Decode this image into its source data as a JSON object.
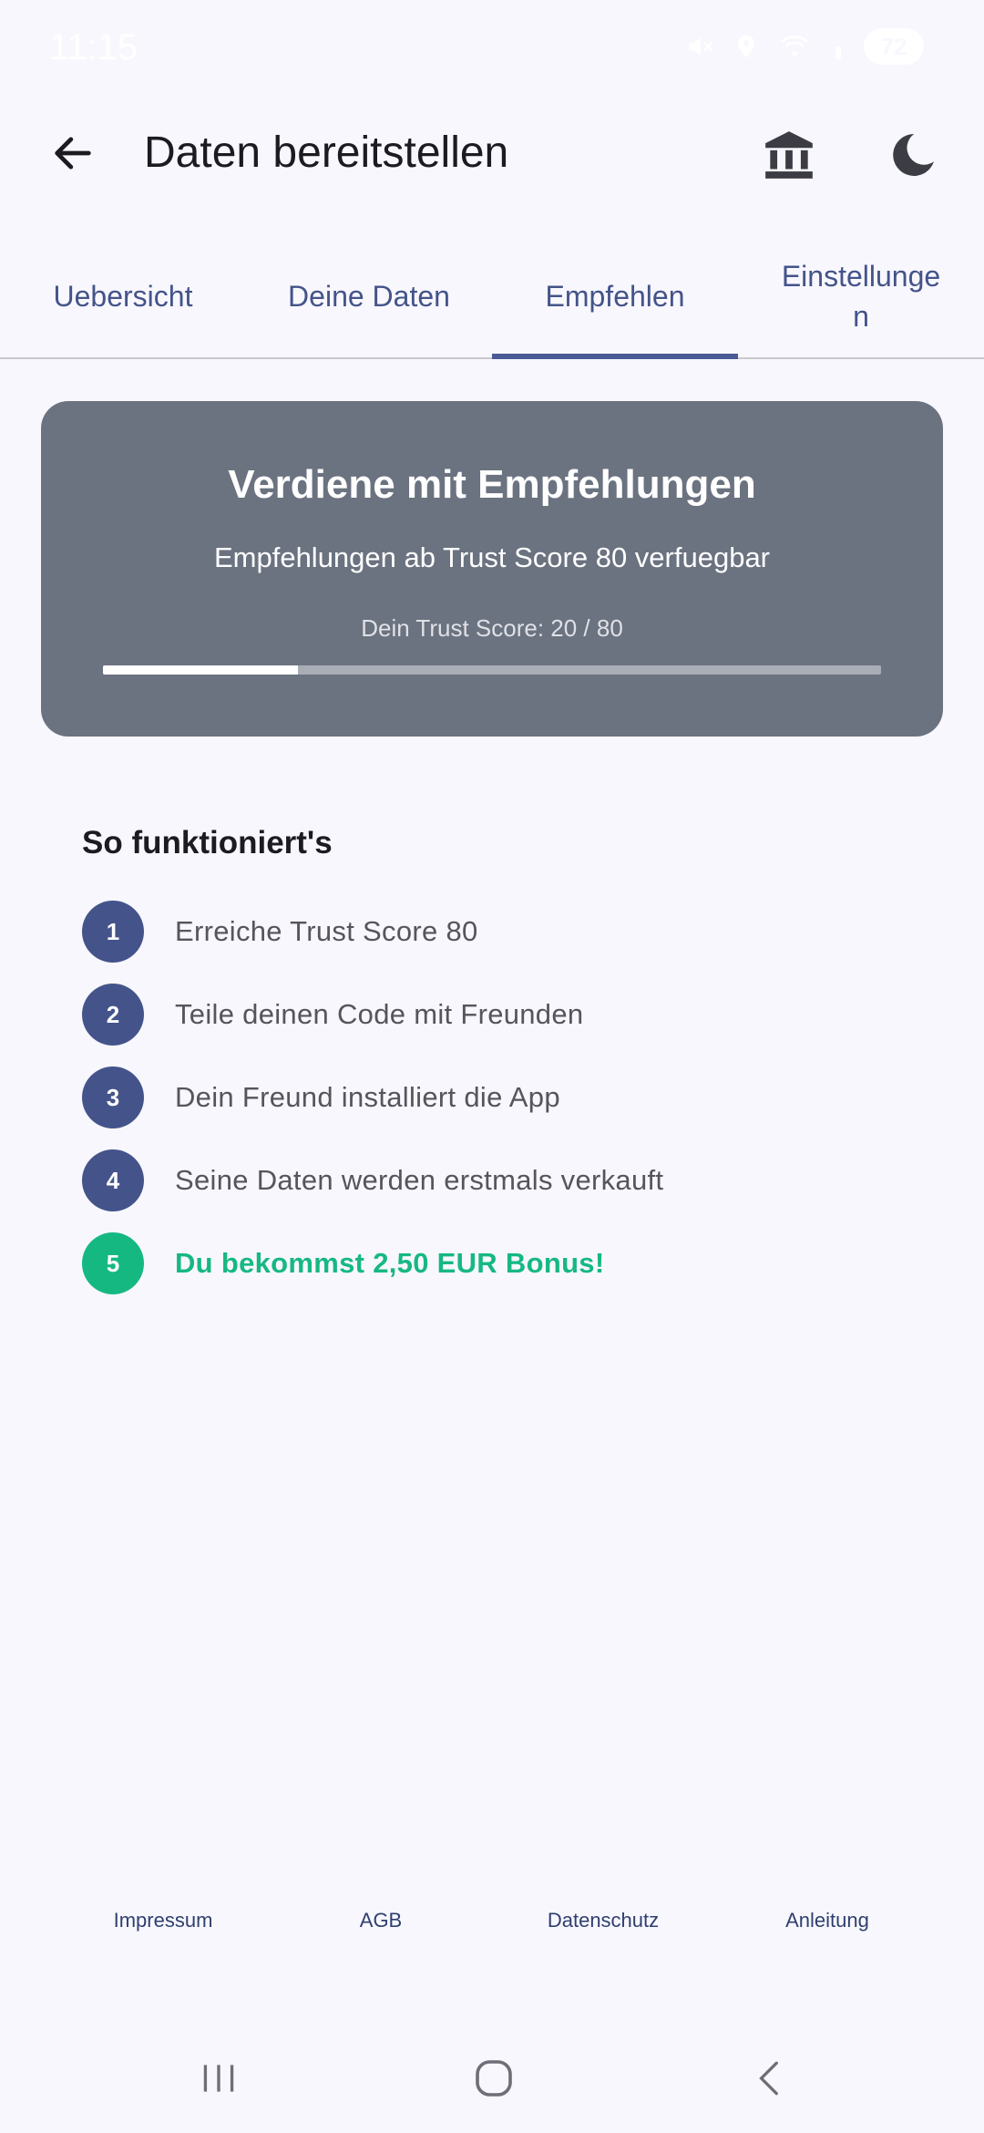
{
  "status_bar": {
    "time": "11:15",
    "battery": "72",
    "icons": [
      "mute-icon",
      "location-icon",
      "wifi-icon",
      "signal-icon",
      "battery-icon"
    ]
  },
  "app_bar": {
    "title": "Daten bereitstellen",
    "back_icon": "arrow-back-icon",
    "actions": [
      "bank-icon",
      "moon-icon"
    ]
  },
  "tabs": [
    {
      "label": "Uebersicht",
      "active": false
    },
    {
      "label": "Deine Daten",
      "active": false
    },
    {
      "label": "Empfehlen",
      "active": true
    },
    {
      "label": "Einstellungen",
      "active": false
    }
  ],
  "hero": {
    "title": "Verdiene mit Empfehlungen",
    "subtitle": "Empfehlungen ab Trust Score 80 verfuegbar",
    "score_text": "Dein Trust Score: 20 / 80",
    "score": 20,
    "score_max": 80
  },
  "steps": {
    "heading": "So funktioniert's",
    "items": [
      {
        "number": "1",
        "text": "Erreiche Trust Score 80"
      },
      {
        "number": "2",
        "text": "Teile deinen Code mit Freunden"
      },
      {
        "number": "3",
        "text": "Dein Freund installiert die App"
      },
      {
        "number": "4",
        "text": "Seine Daten werden erstmals verkauft"
      },
      {
        "number": "5",
        "text": "Du bekommst 2,50 EUR Bonus!"
      }
    ]
  },
  "footer": {
    "links": [
      "Impressum",
      "AGB",
      "Datenschutz",
      "Anleitung"
    ]
  },
  "colors": {
    "primary": "#44548a",
    "success": "#16b882",
    "card": "#6b7280",
    "background": "#f8f7fd"
  }
}
